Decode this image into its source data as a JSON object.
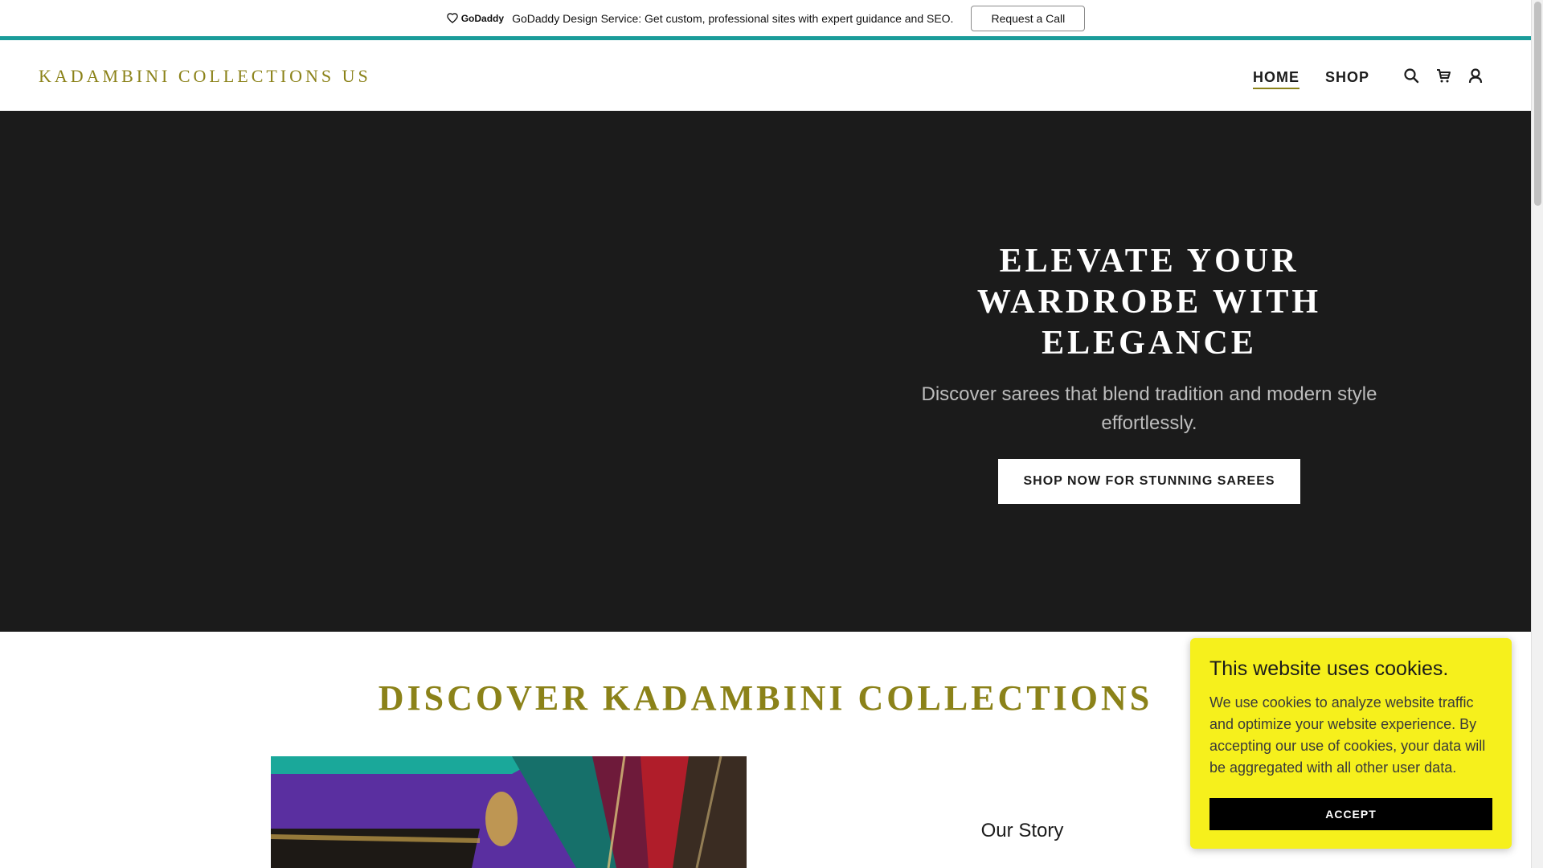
{
  "promo": {
    "logo_text": "GoDaddy",
    "message": "GoDaddy Design Service: Get custom, professional sites with expert guidance and SEO.",
    "button_label": "Request a Call"
  },
  "header": {
    "logo": "KADAMBINI COLLECTIONS US",
    "nav": [
      {
        "label": "HOME",
        "active": true
      },
      {
        "label": "SHOP",
        "active": false
      }
    ],
    "icons": [
      "search-icon",
      "cart-icon",
      "account-icon"
    ]
  },
  "hero": {
    "title": "ELEVATE YOUR WARDROBE WITH ELEGANCE",
    "subtitle": "Discover sarees that blend tradition and modern style effortlessly.",
    "cta_label": "SHOP NOW FOR STUNNING SAREES"
  },
  "section": {
    "title": "DISCOVER KADAMBINI COLLECTIONS",
    "story_title": "Our Story"
  },
  "cookie": {
    "title": "This website uses cookies.",
    "text": "We use cookies to analyze website traffic and optimize your website experience. By accepting our use of cookies, your data will be aggregated with all other user data.",
    "button_label": "ACCEPT"
  },
  "colors": {
    "brand": "#8b8219",
    "accent_line": "#1b9c9a",
    "hero_bg": "#1b1b1b",
    "cookie_bg": "#f6f01c"
  }
}
